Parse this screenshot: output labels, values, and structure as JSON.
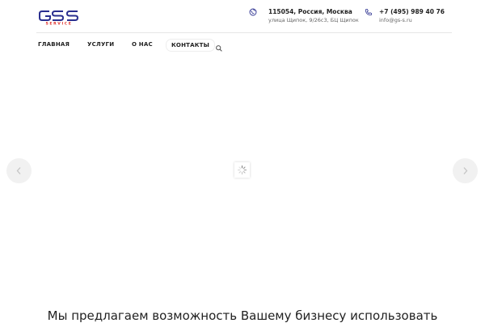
{
  "header": {
    "logo": {
      "letters": "GS",
      "subtitle": "SERVICE",
      "colors": {
        "primary": "#2a2f8f",
        "accent": "#e0312b"
      }
    },
    "address": {
      "icon": "globe-icon",
      "line1": "115054, Россия, Москва",
      "line2": "улица Щипок, 9/26с3, БЦ Щипок"
    },
    "contact": {
      "icon": "phone-icon",
      "phone": "+7 (495) 989 40 76",
      "email": "info@gs-s.ru"
    }
  },
  "nav": {
    "items": [
      {
        "label": "ГЛАВНАЯ"
      },
      {
        "label": "УСЛУГИ"
      },
      {
        "label": "О НАС"
      },
      {
        "label": "КОНТАКТЫ"
      }
    ],
    "search_icon": "search-icon"
  },
  "slider": {
    "prev_icon": "chevron-left-icon",
    "next_icon": "chevron-right-icon",
    "loading_icon": "spinner-icon"
  },
  "tagline": "Мы предлагаем возможность Вашему бизнесу использовать"
}
